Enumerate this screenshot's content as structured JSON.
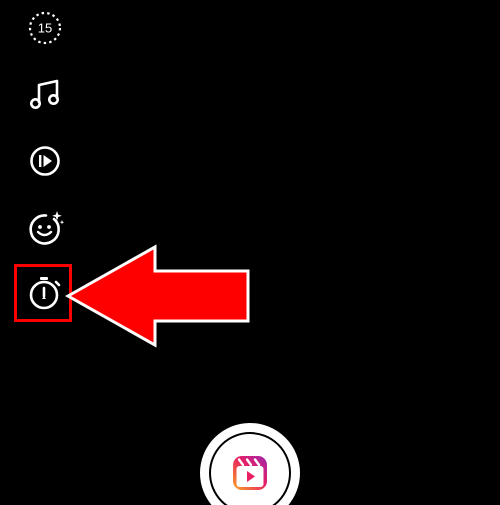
{
  "camera_tools": {
    "length": {
      "value": "15",
      "icon": "length-15-icon"
    },
    "audio": {
      "icon": "music-note-icon"
    },
    "speed": {
      "icon": "play-speed-icon"
    },
    "effects": {
      "icon": "face-sparkle-icon"
    },
    "timer": {
      "icon": "stopwatch-timer-icon",
      "highlighted": true
    }
  },
  "annotation": {
    "box_color": "#ff0000",
    "arrow_color": "#ff0000",
    "arrow_outline": "#ffffff"
  },
  "shutter": {
    "icon": "reels-icon",
    "gradient": [
      "#f9a825",
      "#e91e63",
      "#9c27b0"
    ]
  },
  "colors": {
    "background": "#000000",
    "icon": "#ffffff"
  }
}
